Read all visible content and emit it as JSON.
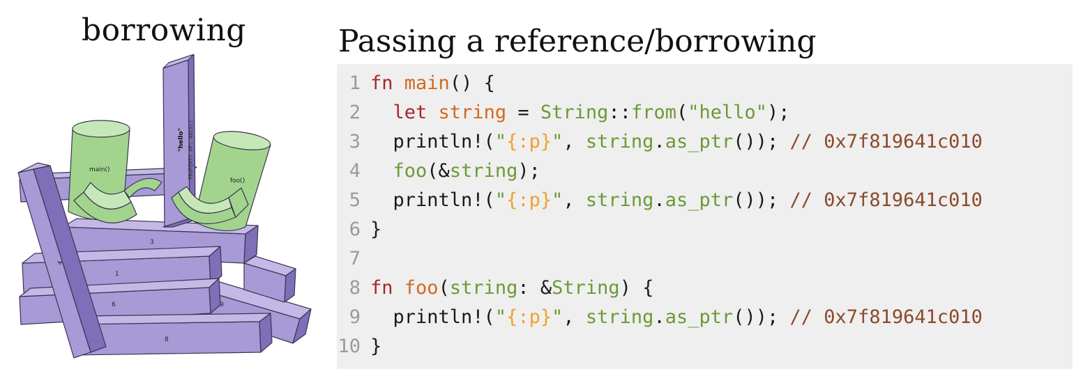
{
  "left_panel": {
    "title": "borrowing",
    "illustration": {
      "labels": {
        "main_cup": "main()",
        "foo_cup": "foo()",
        "pillar_hello": "\"hello\"",
        "pillar_owner": "PROPERTY OF: main()",
        "beam_1": "1",
        "beam_3": "3",
        "beam_4": "4",
        "beam_6": "6",
        "beam_8": "8",
        "beam_9": "9"
      },
      "colors": {
        "beam_fill": "#a89ad6",
        "beam_dark": "#7d6fb8",
        "cup_fill": "#a2d48e",
        "cup_top": "#c6e8b8"
      }
    }
  },
  "right_panel": {
    "title": "Passing a reference/borrowing",
    "code_lines": [
      {
        "n": "1",
        "tokens": [
          [
            "kw",
            "fn"
          ],
          [
            "pl",
            " "
          ],
          [
            "fnname",
            "main"
          ],
          [
            "pl",
            "() {"
          ]
        ]
      },
      {
        "n": "2",
        "tokens": [
          [
            "pl",
            "  "
          ],
          [
            "kw",
            "let"
          ],
          [
            "pl",
            " "
          ],
          [
            "var-orange",
            "string"
          ],
          [
            "pl",
            " = "
          ],
          [
            "ty",
            "String"
          ],
          [
            "pl",
            "::"
          ],
          [
            "ident",
            "from"
          ],
          [
            "pl",
            "("
          ],
          [
            "str",
            "\"hello\""
          ],
          [
            "pl",
            ");"
          ]
        ]
      },
      {
        "n": "3",
        "tokens": [
          [
            "pl",
            "  println!("
          ],
          [
            "str",
            "\""
          ],
          [
            "fmt",
            "{:p}"
          ],
          [
            "str",
            "\""
          ],
          [
            "pl",
            ", "
          ],
          [
            "ident",
            "string"
          ],
          [
            "pl",
            "."
          ],
          [
            "ident",
            "as_ptr"
          ],
          [
            "pl",
            "()); "
          ],
          [
            "cmt",
            "// 0x7f819641c010"
          ]
        ]
      },
      {
        "n": "4",
        "tokens": [
          [
            "pl",
            "  "
          ],
          [
            "ident",
            "foo"
          ],
          [
            "pl",
            "(&"
          ],
          [
            "ident",
            "string"
          ],
          [
            "pl",
            ");"
          ]
        ]
      },
      {
        "n": "5",
        "tokens": [
          [
            "pl",
            "  println!("
          ],
          [
            "str",
            "\""
          ],
          [
            "fmt",
            "{:p}"
          ],
          [
            "str",
            "\""
          ],
          [
            "pl",
            ", "
          ],
          [
            "ident",
            "string"
          ],
          [
            "pl",
            "."
          ],
          [
            "ident",
            "as_ptr"
          ],
          [
            "pl",
            "()); "
          ],
          [
            "cmt",
            "// 0x7f819641c010"
          ]
        ]
      },
      {
        "n": "6",
        "tokens": [
          [
            "pl",
            "}"
          ]
        ]
      },
      {
        "n": "7",
        "tokens": []
      },
      {
        "n": "8",
        "tokens": [
          [
            "kw",
            "fn"
          ],
          [
            "pl",
            " "
          ],
          [
            "fnname",
            "foo"
          ],
          [
            "pl",
            "("
          ],
          [
            "ident",
            "string"
          ],
          [
            "pl",
            ": &"
          ],
          [
            "ty",
            "String"
          ],
          [
            "pl",
            ") {"
          ]
        ]
      },
      {
        "n": "9",
        "tokens": [
          [
            "pl",
            "  println!("
          ],
          [
            "str",
            "\""
          ],
          [
            "fmt",
            "{:p}"
          ],
          [
            "str",
            "\""
          ],
          [
            "pl",
            ", "
          ],
          [
            "ident",
            "string"
          ],
          [
            "pl",
            "."
          ],
          [
            "ident",
            "as_ptr"
          ],
          [
            "pl",
            "()); "
          ],
          [
            "cmt",
            "// 0x7f819641c010"
          ]
        ]
      },
      {
        "n": "10",
        "tokens": [
          [
            "pl",
            "}"
          ]
        ]
      }
    ]
  }
}
